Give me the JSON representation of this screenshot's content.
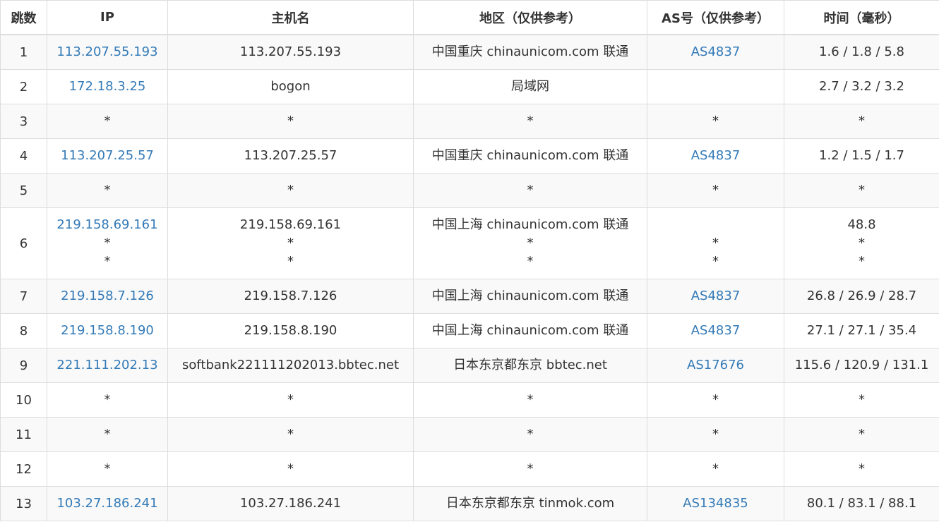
{
  "headers": [
    "跳数",
    "IP",
    "主机名",
    "地区（仅供参考）",
    "AS号（仅供参考）",
    "时间（毫秒）"
  ],
  "rows": [
    {
      "hop": "1",
      "ip": [
        "113.207.55.193"
      ],
      "host": [
        "113.207.55.193"
      ],
      "region": [
        "中国重庆 chinaunicom.com 联通"
      ],
      "as": [
        "AS4837"
      ],
      "time": [
        "1.6 / 1.8 / 5.8"
      ]
    },
    {
      "hop": "2",
      "ip": [
        "172.18.3.25"
      ],
      "host": [
        "bogon"
      ],
      "region": [
        "局域网"
      ],
      "as": [
        ""
      ],
      "time": [
        "2.7 / 3.2 / 3.2"
      ]
    },
    {
      "hop": "3",
      "ip": [
        "*"
      ],
      "host": [
        "*"
      ],
      "region": [
        "*"
      ],
      "as": [
        "*"
      ],
      "time": [
        "*"
      ]
    },
    {
      "hop": "4",
      "ip": [
        "113.207.25.57"
      ],
      "host": [
        "113.207.25.57"
      ],
      "region": [
        "中国重庆 chinaunicom.com 联通"
      ],
      "as": [
        "AS4837"
      ],
      "time": [
        "1.2 / 1.5 / 1.7"
      ]
    },
    {
      "hop": "5",
      "ip": [
        "*"
      ],
      "host": [
        "*"
      ],
      "region": [
        "*"
      ],
      "as": [
        "*"
      ],
      "time": [
        "*"
      ]
    },
    {
      "hop": "6",
      "ip": [
        "219.158.69.161",
        "*",
        "*"
      ],
      "host": [
        "219.158.69.161",
        "*",
        "*"
      ],
      "region": [
        "中国上海 chinaunicom.com 联通",
        "*",
        "*"
      ],
      "as": [
        "",
        "*",
        "*"
      ],
      "time": [
        "48.8",
        "*",
        "*"
      ]
    },
    {
      "hop": "7",
      "ip": [
        "219.158.7.126"
      ],
      "host": [
        "219.158.7.126"
      ],
      "region": [
        "中国上海 chinaunicom.com 联通"
      ],
      "as": [
        "AS4837"
      ],
      "time": [
        "26.8 / 26.9 / 28.7"
      ]
    },
    {
      "hop": "8",
      "ip": [
        "219.158.8.190"
      ],
      "host": [
        "219.158.8.190"
      ],
      "region": [
        "中国上海 chinaunicom.com 联通"
      ],
      "as": [
        "AS4837"
      ],
      "time": [
        "27.1 / 27.1 / 35.4"
      ]
    },
    {
      "hop": "9",
      "ip": [
        "221.111.202.13"
      ],
      "host": [
        "softbank221111202013.bbtec.net"
      ],
      "region": [
        "日本东京都东京 bbtec.net"
      ],
      "as": [
        "AS17676"
      ],
      "time": [
        "115.6 / 120.9 / 131.1"
      ]
    },
    {
      "hop": "10",
      "ip": [
        "*"
      ],
      "host": [
        "*"
      ],
      "region": [
        "*"
      ],
      "as": [
        "*"
      ],
      "time": [
        "*"
      ]
    },
    {
      "hop": "11",
      "ip": [
        "*"
      ],
      "host": [
        "*"
      ],
      "region": [
        "*"
      ],
      "as": [
        "*"
      ],
      "time": [
        "*"
      ]
    },
    {
      "hop": "12",
      "ip": [
        "*"
      ],
      "host": [
        "*"
      ],
      "region": [
        "*"
      ],
      "as": [
        "*"
      ],
      "time": [
        "*"
      ]
    },
    {
      "hop": "13",
      "ip": [
        "103.27.186.241"
      ],
      "host": [
        "103.27.186.241"
      ],
      "region": [
        "日本东京都东京 tinmok.com"
      ],
      "as": [
        "AS134835"
      ],
      "time": [
        "80.1 / 83.1 / 88.1"
      ]
    }
  ],
  "colors": {
    "link": "#337ab7",
    "text": "#333333",
    "border": "#dddddd",
    "stripe": "#f9f9f9"
  }
}
